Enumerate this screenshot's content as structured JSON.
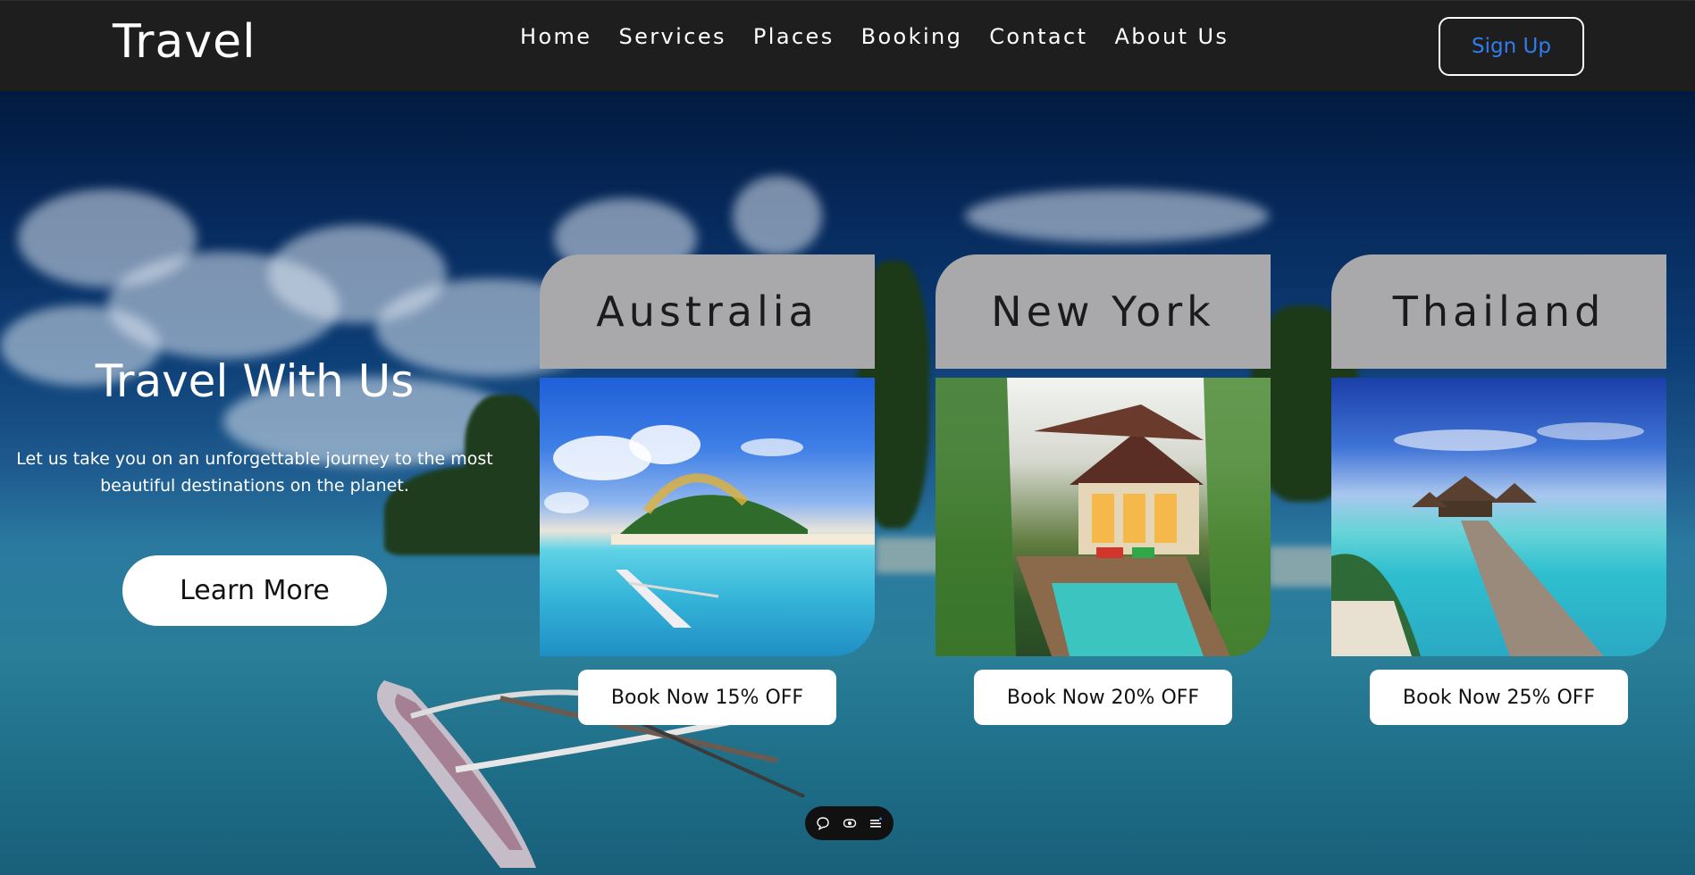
{
  "navbar": {
    "logo": "Travel",
    "links": [
      "Home",
      "Services",
      "Places",
      "Booking",
      "Contact",
      "About Us"
    ],
    "signup_label": "Sign Up"
  },
  "hero": {
    "title": "Travel With Us",
    "description": "Let us take you on an unforgettable journey to the most beautiful destinations on the planet.",
    "cta_label": "Learn More"
  },
  "destinations": [
    {
      "name": "Australia",
      "button": "Book Now 15% OFF"
    },
    {
      "name": "New York",
      "button": "Book Now 20% OFF"
    },
    {
      "name": "Thailand",
      "button": "Book Now 25% OFF"
    }
  ],
  "toolbar": {
    "icons": [
      "comment-icon",
      "eye-icon",
      "menu-icon"
    ]
  },
  "colors": {
    "navbar_bg": "#1e1e1e",
    "signup_text": "#2f7df0",
    "card_header_bg": "#a9a8aa"
  }
}
